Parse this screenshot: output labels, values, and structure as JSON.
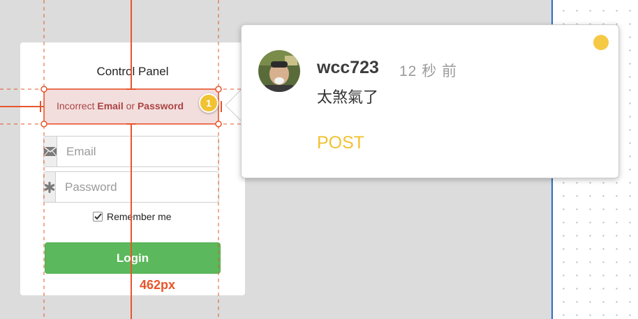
{
  "login": {
    "title": "Control Panel",
    "error": {
      "prefix": "Incorrect ",
      "field1": "Email",
      "joiner": " or ",
      "field2": "Password"
    },
    "email_placeholder": "Email",
    "password_placeholder": "Password",
    "remember_label": "Remember me",
    "remember_checked": true,
    "login_label": "Login",
    "login_color": "#5cb85c",
    "error_bg": "#f3dede"
  },
  "overlay": {
    "width_label": "462px",
    "marker_number": "1",
    "guide_color": "#e8552a",
    "marker_color": "#f1c232"
  },
  "comment": {
    "username": "wcc723",
    "time": "12 秒 前",
    "text": "太煞氣了",
    "post_label": "POST",
    "accent": "#f1c232"
  },
  "icons": {
    "email_field": "envelope-icon",
    "password_field": "asterisk-icon",
    "remember": "check-icon",
    "status": "status-dot-icon"
  }
}
